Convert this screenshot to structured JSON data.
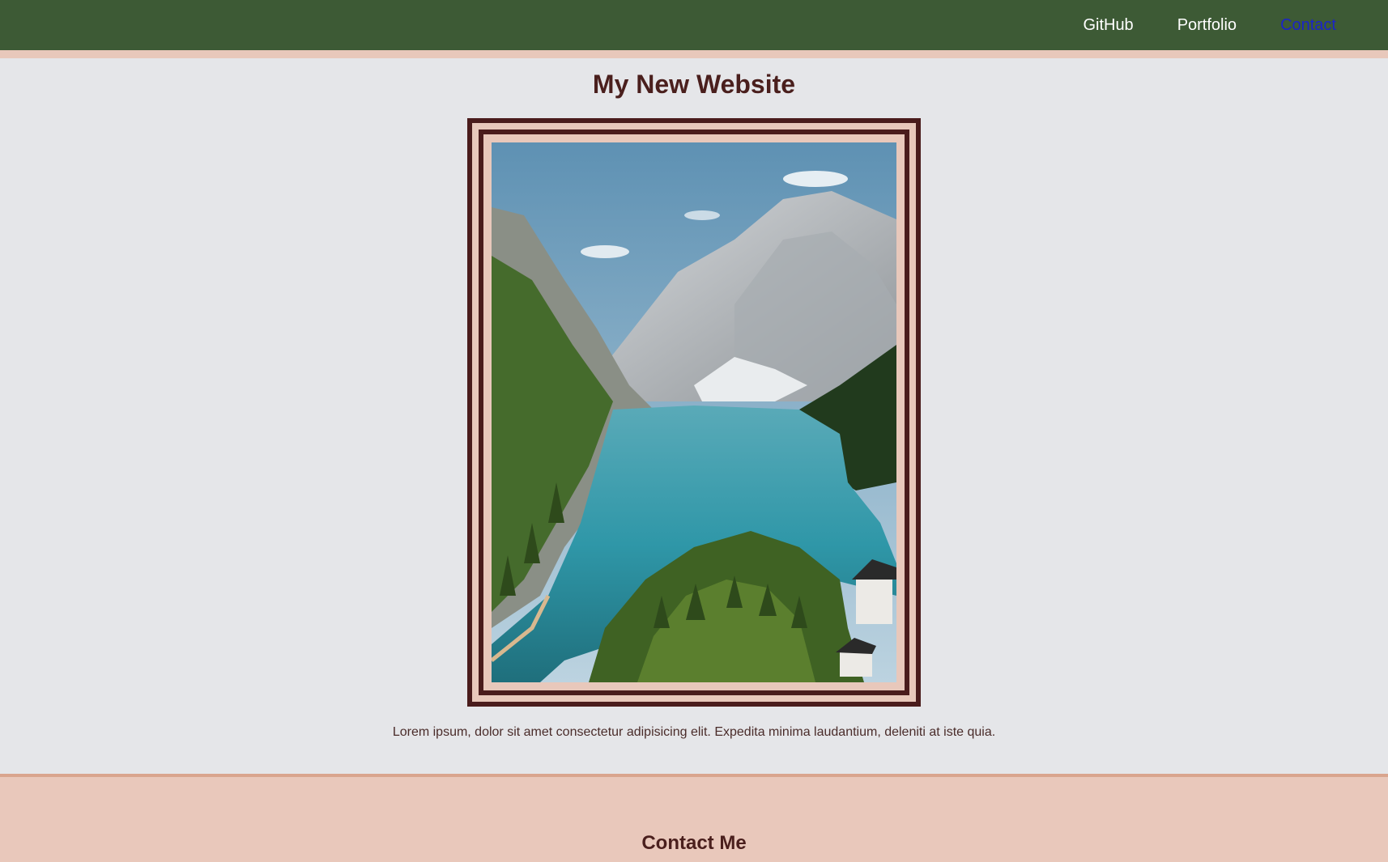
{
  "nav": {
    "links": [
      {
        "label": "GitHub"
      },
      {
        "label": "Portfolio"
      },
      {
        "label": "Contact"
      }
    ]
  },
  "main": {
    "title": "My New Website",
    "image_icon": "mountain-lake-photo",
    "caption": "Lorem ipsum, dolor sit amet consectetur adipisicing elit. Expedita minima laudantium, deleniti at iste quia."
  },
  "contact": {
    "title": "Contact Me"
  },
  "colors": {
    "nav_bg": "#3d5a35",
    "accent_pink": "#e8c8bb",
    "frame_dark": "#4a1c1c",
    "active_link": "#1a24c8",
    "page_bg": "#e5e6e9"
  }
}
